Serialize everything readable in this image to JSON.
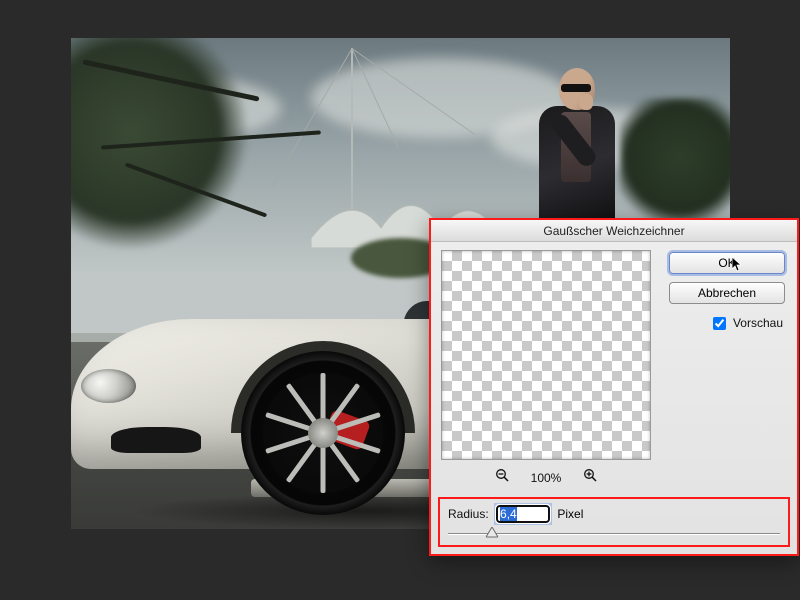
{
  "dialog": {
    "title": "Gaußscher Weichzeichner",
    "ok_label": "OK",
    "cancel_label": "Abbrechen",
    "preview_label": "Vorschau",
    "preview_checked": true,
    "zoom_level": "100%",
    "radius_label": "Radius:",
    "radius_value": "6,4",
    "radius_unit": "Pixel"
  }
}
